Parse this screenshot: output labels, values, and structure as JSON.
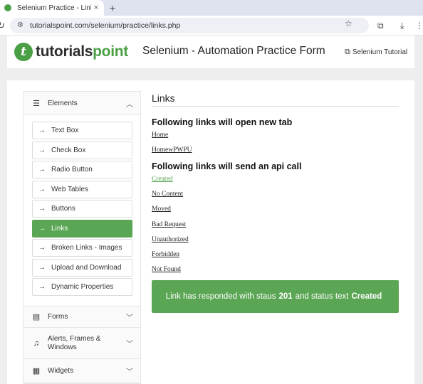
{
  "browser": {
    "tab_title": "Selenium Practice - Links",
    "tab_close": "×",
    "new_tab": "+",
    "url": "tutorialspoint.com/selenium/practice/links.php"
  },
  "header": {
    "logo_prefix": "tutorials",
    "logo_suffix": "point",
    "page_heading": "Selenium - Automation Practice Form",
    "tutorial_link": "Selenium Tutorial"
  },
  "sidebar": {
    "elements_label": "Elements",
    "items": [
      {
        "label": "Text Box"
      },
      {
        "label": "Check Box"
      },
      {
        "label": "Radio Button"
      },
      {
        "label": "Web Tables"
      },
      {
        "label": "Buttons"
      },
      {
        "label": "Links",
        "active": true
      },
      {
        "label": "Broken Links - Images"
      },
      {
        "label": "Upload and Download"
      },
      {
        "label": "Dynamic Properties"
      }
    ],
    "forms_label": "Forms",
    "alerts_label": "Alerts, Frames & Windows",
    "widgets_label": "Widgets"
  },
  "main": {
    "title": "Links",
    "new_tab_heading": "Following links will open new tab",
    "new_tab_links": [
      "Home",
      "HomewPWPU"
    ],
    "api_heading": "Following links will send an api call",
    "api_links": [
      "Created",
      "No Content",
      "Moved",
      "Bad Request",
      "Unauthorized",
      "Forbidden",
      "Not Found"
    ],
    "alert": {
      "prefix": "Link has responded with staus",
      "status_code": "201",
      "middle": "and status text",
      "status_text": "Created"
    }
  },
  "colors": {
    "brand_green": "#4a9f45",
    "active_green": "#5ba654"
  },
  "icons": [
    "favicon-icon",
    "reload-icon",
    "site-info-icon",
    "star-icon",
    "extensions-icon",
    "download-icon",
    "more-icon",
    "external-link-icon",
    "menu-icon",
    "chevron-down-icon",
    "arrow-right-icon",
    "forms-icon",
    "bell-icon",
    "widgets-icon"
  ]
}
